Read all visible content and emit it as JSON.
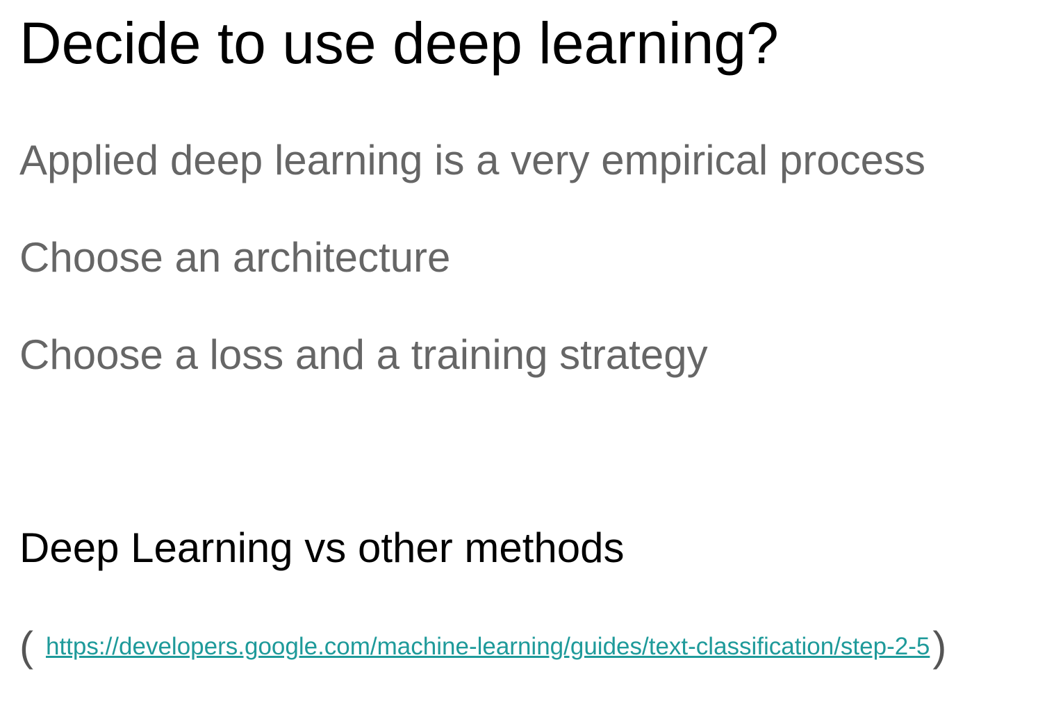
{
  "slide": {
    "title": "Decide to use deep learning?",
    "bullets": [
      "Applied deep learning is a very empirical process",
      "Choose an architecture",
      "Choose a loss and a training strategy"
    ],
    "subheading": "Deep Learning vs other methods",
    "reference": {
      "open_paren": "(",
      "link_text": "https://developers.google.com/machine-learning/guides/text-classification/step-2-5",
      "close_paren": ")"
    }
  }
}
